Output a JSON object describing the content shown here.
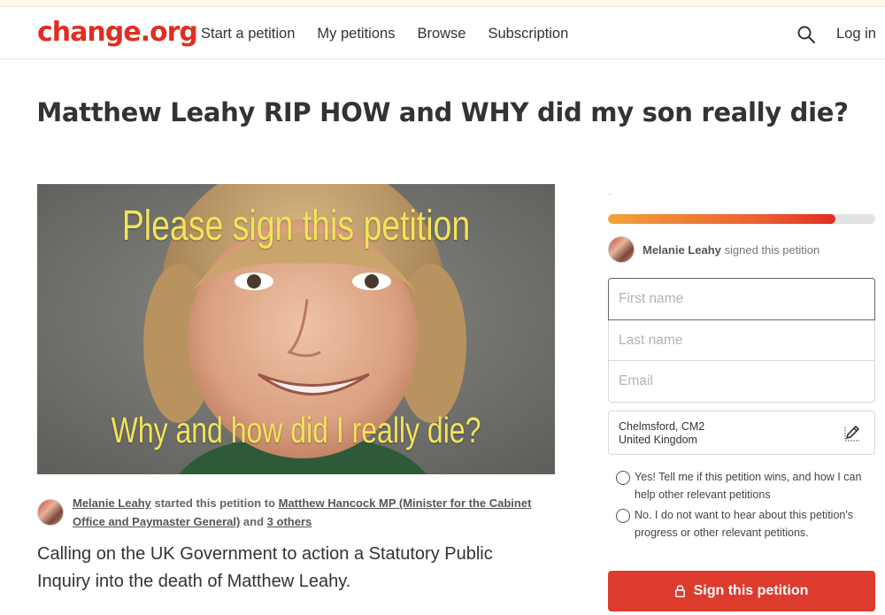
{
  "header": {
    "logo": "change.org",
    "nav": [
      "Start a petition",
      "My petitions",
      "Browse",
      "Subscription"
    ],
    "login": "Log in"
  },
  "petition": {
    "title": "Matthew Leahy RIP HOW and WHY did my son really die?",
    "image": {
      "caption_top": "Please sign this petition",
      "caption_bottom": "Why and how did I really die?"
    },
    "starter": {
      "name": "Melanie Leahy",
      "mid": " started this petition to ",
      "target": "Matthew Hancock MP (Minister for the Cabinet Office and Paymaster General)",
      "and": " and ",
      "others": "3 others"
    },
    "lead": "Calling on the UK Government to action a Statutory Public Inquiry into the death of Matthew Leahy."
  },
  "sidebar": {
    "progress_label": "-",
    "progress_fraction": 0.85,
    "recent_signer": {
      "name": "Melanie Leahy",
      "action": " signed this petition"
    },
    "form": {
      "first_name_placeholder": "First name",
      "last_name_placeholder": "Last name",
      "email_placeholder": "Email",
      "location_line1": "Chelmsford, CM2",
      "location_line2": "United Kingdom"
    },
    "options": [
      "Yes! Tell me if this petition wins, and how I can help other relevant petitions",
      "No. I do not want to hear about this petition's progress or other relevant petitions."
    ],
    "sign_button": "Sign this petition"
  },
  "colors": {
    "brand": "#e02e22",
    "button": "#dd3b2e",
    "progress_start": "#f0a33b",
    "progress_end": "#e02e22"
  },
  "icons": [
    "search-icon",
    "edit-location-icon",
    "lock-icon"
  ]
}
